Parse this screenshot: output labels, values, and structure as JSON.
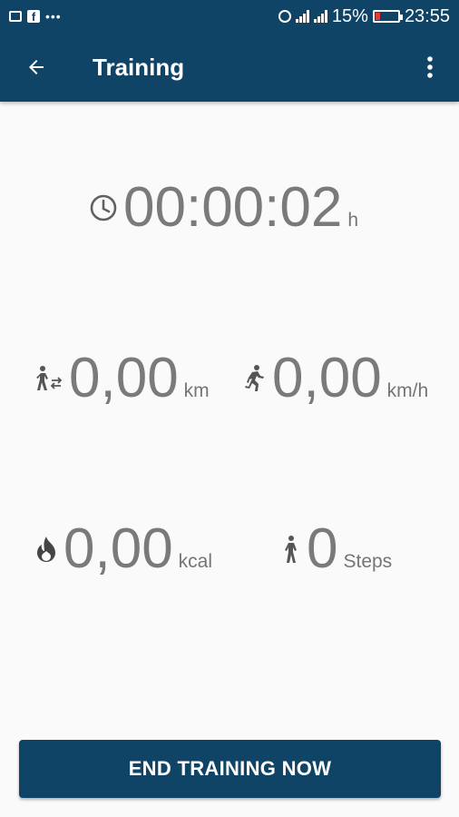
{
  "status_bar": {
    "battery": "15%",
    "time": "23:55",
    "icons": [
      "image-icon",
      "facebook-icon",
      "more-dots-icon",
      "alarm-icon",
      "signal-icon",
      "signal-icon",
      "battery-icon"
    ]
  },
  "app_bar": {
    "title": "Training",
    "back_icon": "arrow-back-icon",
    "menu_icon": "more-vert-icon"
  },
  "stats": {
    "duration": {
      "value": "00:00:02",
      "unit": "h",
      "icon": "clock-icon"
    },
    "distance": {
      "value": "0,00",
      "unit": "km",
      "icon": "walking-distance-icon"
    },
    "speed": {
      "value": "0,00",
      "unit": "km/h",
      "icon": "running-icon"
    },
    "calories": {
      "value": "0,00",
      "unit": "kcal",
      "icon": "flame-icon"
    },
    "steps": {
      "value": "0",
      "unit": "Steps",
      "icon": "walking-icon"
    }
  },
  "actions": {
    "end_training_label": "END TRAINING NOW"
  },
  "colors": {
    "primary": "#0f4466",
    "text": "#7a7a7a",
    "background": "#fafafa",
    "battery_low": "#e53935"
  }
}
